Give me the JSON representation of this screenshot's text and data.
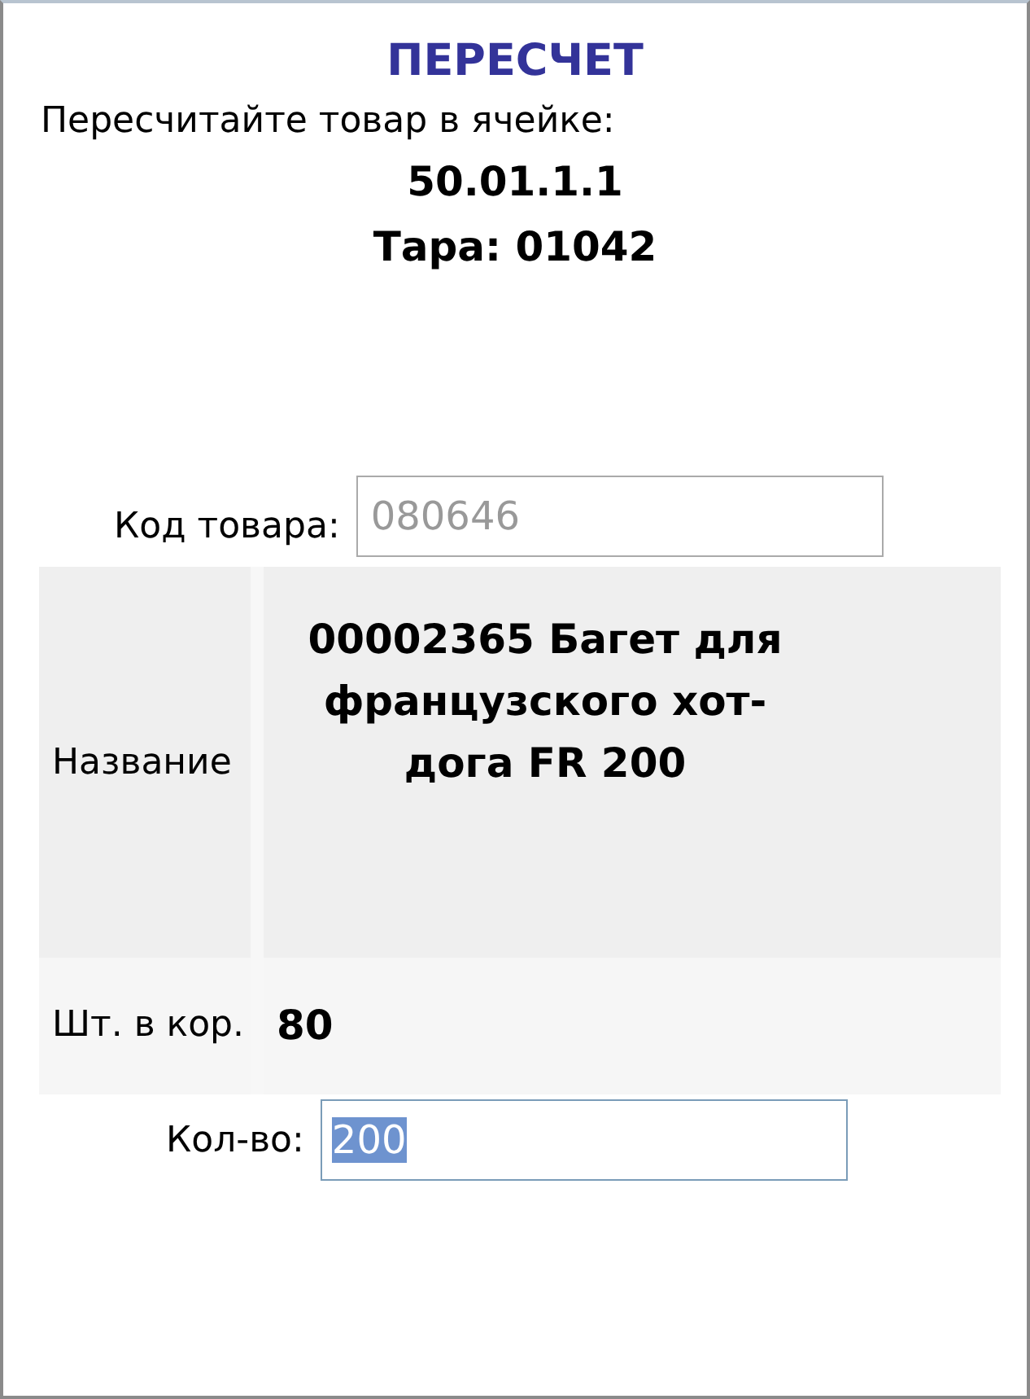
{
  "title": "ПЕРЕСЧЕТ",
  "prompt": "Пересчитайте товар в ячейке:",
  "cell": "50.01.1.1",
  "container": "Тара: 01042",
  "code_field": {
    "label": "Код товара:",
    "value": "080646",
    "disabled": true
  },
  "details": [
    {
      "label": "Название",
      "value": "00002365 Багет для французского хот-дога FR 200",
      "kind": "tall"
    },
    {
      "label": "Шт. в кор.",
      "value": "80",
      "kind": "short"
    }
  ],
  "quantity_field": {
    "label": "Кол-во:",
    "value": "200",
    "text_selected": true
  }
}
